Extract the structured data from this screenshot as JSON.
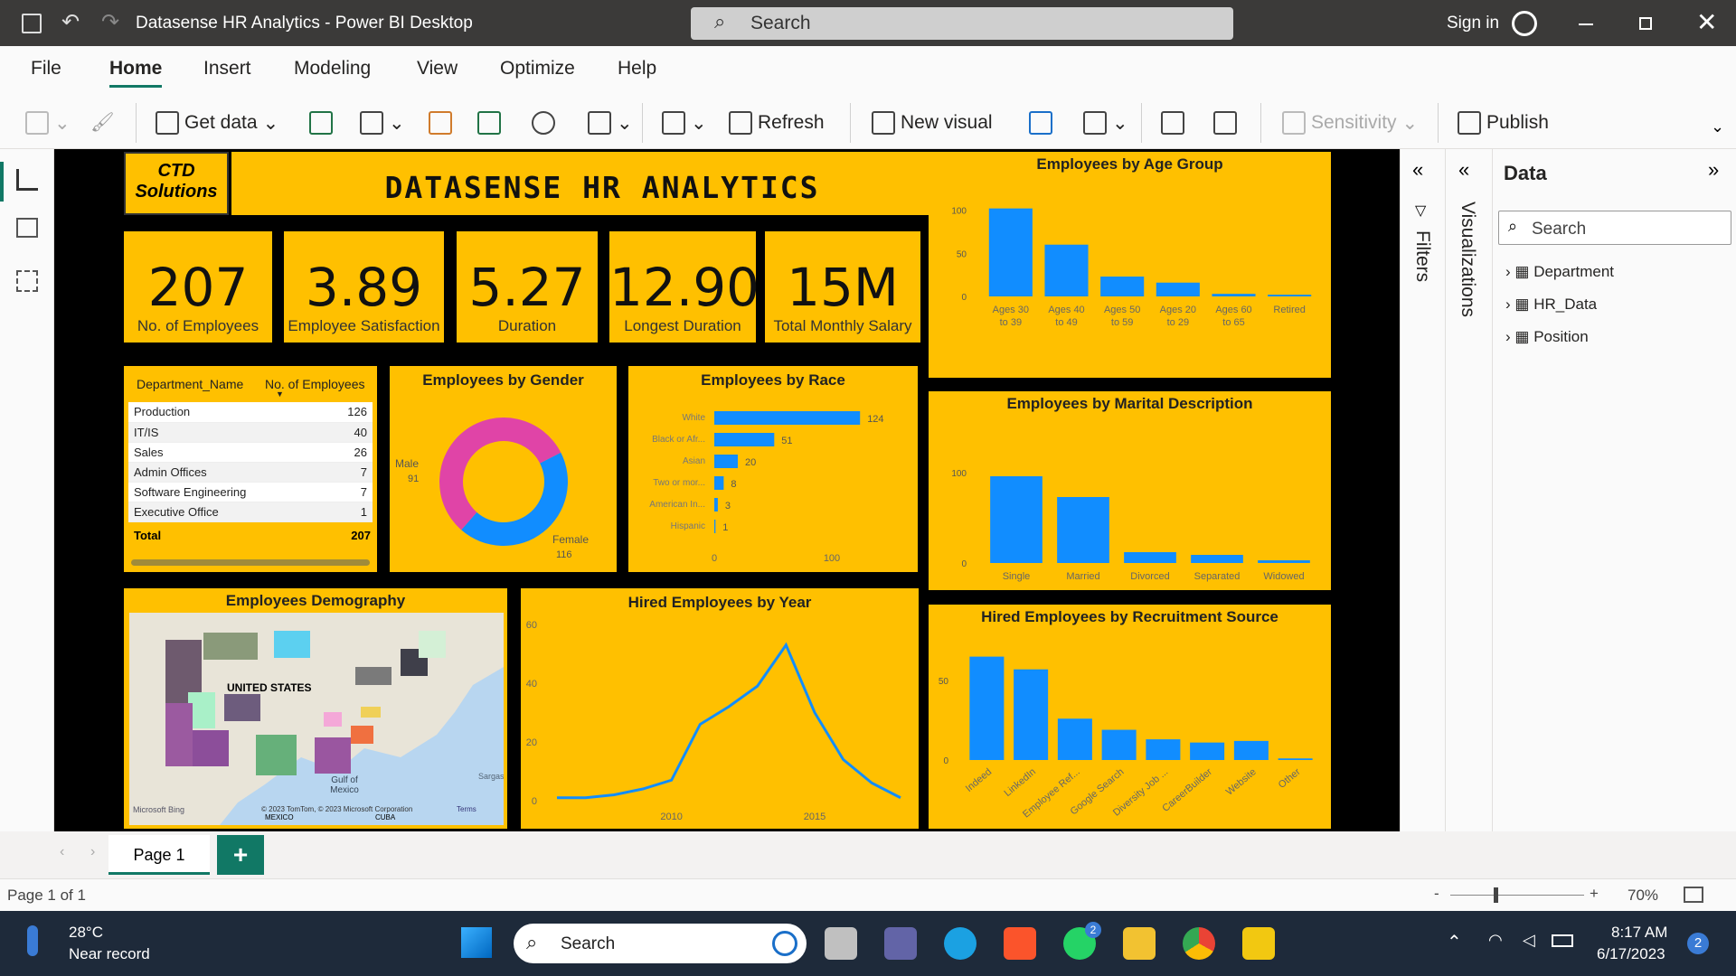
{
  "window": {
    "title": "Datasense HR Analytics - Power BI Desktop",
    "search_placeholder": "Search",
    "sign_in": "Sign in"
  },
  "menu": [
    "File",
    "Home",
    "Insert",
    "Modeling",
    "View",
    "Optimize",
    "Help"
  ],
  "ribbon": {
    "get_data": "Get data",
    "refresh": "Refresh",
    "new_visual": "New visual",
    "sensitivity": "Sensitivity",
    "publish": "Publish"
  },
  "report": {
    "logo_line1": "CTD",
    "logo_line2": "Solutions",
    "title": "DATASENSE HR ANALYTICS",
    "kpis": [
      {
        "value": "207",
        "label": "No. of Employees"
      },
      {
        "value": "3.89",
        "label": "Employee Satisfaction"
      },
      {
        "value": "5.27",
        "label": "Duration"
      },
      {
        "value": "12.90",
        "label": "Longest Duration"
      },
      {
        "value": "15M",
        "label": "Total Monthly Salary"
      }
    ],
    "dept_table": {
      "headers": [
        "Department_Name",
        "No. of Employees"
      ],
      "rows": [
        [
          "Production",
          "126"
        ],
        [
          "IT/IS",
          "40"
        ],
        [
          "Sales",
          "26"
        ],
        [
          "Admin Offices",
          "7"
        ],
        [
          "Software Engineering",
          "7"
        ],
        [
          "Executive Office",
          "1"
        ]
      ],
      "total_label": "Total",
      "total_value": "207"
    },
    "map": {
      "title": "Employees Demography",
      "country_label": "UNITED STATES",
      "gulf_label": "Gulf of Mexico",
      "mexico_label": "MEXICO",
      "cuba_label": "CUBA",
      "sargasso_label": "Sargas",
      "bing": "Microsoft Bing",
      "credit": "© 2023 TomTom, © 2023 Microsoft Corporation",
      "terms": "Terms"
    }
  },
  "chart_data": [
    {
      "id": "age",
      "type": "bar",
      "title": "Employees by Age Group",
      "categories": [
        "Ages 30 to 39",
        "Ages 40 to 49",
        "Ages 50 to 59",
        "Ages 20 to 29",
        "Ages 60 to 65",
        "Retired"
      ],
      "cat_lines": [
        [
          "Ages 30",
          "to 39"
        ],
        [
          "Ages 40",
          "to 49"
        ],
        [
          "Ages 50",
          "to 59"
        ],
        [
          "Ages 20",
          "to 29"
        ],
        [
          "Ages 60",
          "to 65"
        ],
        [
          "Retired"
        ]
      ],
      "values": [
        102,
        60,
        23,
        16,
        3,
        2
      ],
      "yticks": [
        0,
        50,
        100
      ],
      "ylim": [
        0,
        110
      ],
      "color": "#118dff"
    },
    {
      "id": "marital",
      "type": "bar",
      "title": "Employees by Marital Description",
      "categories": [
        "Single",
        "Married",
        "Divorced",
        "Separated",
        "Widowed"
      ],
      "values": [
        96,
        73,
        12,
        9,
        3
      ],
      "yticks": [
        0,
        100
      ],
      "ylim": [
        0,
        110
      ],
      "color": "#118dff"
    },
    {
      "id": "recruit",
      "type": "bar",
      "title": "Hired Employees by Recruitment Source",
      "categories": [
        "Indeed",
        "LinkedIn",
        "Employee Ref...",
        "Google Search",
        "Diversity Job ...",
        "CareerBuilder",
        "Website",
        "Other"
      ],
      "values": [
        65,
        57,
        26,
        19,
        13,
        11,
        12,
        1
      ],
      "yticks": [
        0,
        50
      ],
      "ylim": [
        0,
        75
      ],
      "color": "#118dff"
    },
    {
      "id": "race",
      "type": "hbar",
      "title": "Employees by Race",
      "categories": [
        "White",
        "Black or Afr...",
        "Asian",
        "Two or mor...",
        "American In...",
        "Hispanic"
      ],
      "values": [
        124,
        51,
        20,
        8,
        3,
        1
      ],
      "xticks": [
        0,
        100
      ],
      "xlim": [
        0,
        150
      ],
      "color": "#118dff"
    },
    {
      "id": "gender",
      "type": "pie",
      "title": "Employees by Gender",
      "slices": [
        {
          "label": "Male",
          "value": 91,
          "color": "#118dff"
        },
        {
          "label": "Female",
          "value": 116,
          "color": "#e044a7"
        }
      ]
    },
    {
      "id": "year",
      "type": "line",
      "title": "Hired Employees by Year",
      "x": [
        2006,
        2007,
        2008,
        2009,
        2010,
        2011,
        2012,
        2013,
        2014,
        2015,
        2016,
        2017,
        2018
      ],
      "values": [
        1,
        1,
        2,
        4,
        7,
        26,
        32,
        39,
        53,
        30,
        14,
        6,
        1
      ],
      "xticks": [
        2010,
        2015
      ],
      "yticks": [
        0,
        20,
        40,
        60
      ],
      "ylim": [
        0,
        60
      ],
      "color": "#118dff"
    }
  ],
  "panes": {
    "filters": "Filters",
    "visualizations": "Visualizations",
    "data_title": "Data",
    "data_search": "Search",
    "tables": [
      "Department",
      "HR_Data",
      "Position"
    ]
  },
  "pages": {
    "tab": "Page 1",
    "add": "+",
    "status": "Page 1 of 1",
    "zoom": "70%"
  },
  "taskbar": {
    "temp": "28°C",
    "weather": "Near record",
    "search": "Search",
    "time": "8:17 AM",
    "date": "6/17/2023",
    "notif": "2",
    "whatsapp_badge": "2"
  }
}
